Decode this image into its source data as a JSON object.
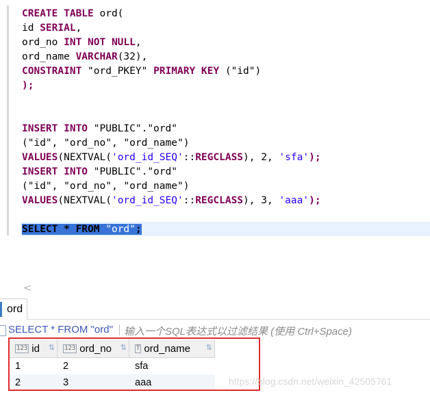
{
  "editor": {
    "lines": [
      [
        {
          "t": "CREATE TABLE",
          "k": "kw"
        },
        {
          "t": " ord(",
          "k": "fn"
        }
      ],
      [
        {
          "t": "id ",
          "k": "fn"
        },
        {
          "t": "SERIAL",
          "k": "kw"
        },
        {
          "t": ",",
          "k": "fn"
        }
      ],
      [
        {
          "t": "ord_no ",
          "k": "fn"
        },
        {
          "t": "INT NOT NULL",
          "k": "kw"
        },
        {
          "t": ",",
          "k": "fn"
        }
      ],
      [
        {
          "t": "ord_name ",
          "k": "fn"
        },
        {
          "t": "VARCHAR",
          "k": "kw"
        },
        {
          "t": "(32),",
          "k": "fn"
        }
      ],
      [
        {
          "t": "CONSTRAINT",
          "k": "kw"
        },
        {
          "t": " \"ord_PKEY\" ",
          "k": "dq"
        },
        {
          "t": "PRIMARY KEY",
          "k": "kw"
        },
        {
          "t": " (\"id\")",
          "k": "dq"
        }
      ],
      [
        {
          "t": ");",
          "k": "kw"
        }
      ],
      [],
      [],
      [
        {
          "t": "INSERT INTO",
          "k": "kw"
        },
        {
          "t": " \"PUBLIC\".\"ord\"",
          "k": "dq"
        }
      ],
      [
        {
          "t": "(\"id\", \"ord_no\", \"ord_name\")",
          "k": "dq"
        }
      ],
      [
        {
          "t": "VALUES",
          "k": "kw"
        },
        {
          "t": "(NEXTVAL(",
          "k": "fn"
        },
        {
          "t": "'ord_id_SEQ'",
          "k": "str"
        },
        {
          "t": "::",
          "k": "fn"
        },
        {
          "t": "REGCLASS",
          "k": "kw"
        },
        {
          "t": "), 2, ",
          "k": "fn"
        },
        {
          "t": "'sfa'",
          "k": "str"
        },
        {
          "t": ");",
          "k": "kw"
        }
      ],
      [
        {
          "t": "INSERT INTO",
          "k": "kw"
        },
        {
          "t": " \"PUBLIC\".\"ord\"",
          "k": "dq"
        }
      ],
      [
        {
          "t": "(\"id\", \"ord_no\", \"ord_name\")",
          "k": "dq"
        }
      ],
      [
        {
          "t": "VALUES",
          "k": "kw"
        },
        {
          "t": "(NEXTVAL(",
          "k": "fn"
        },
        {
          "t": "'ord_id_SEQ'",
          "k": "str"
        },
        {
          "t": "::",
          "k": "fn"
        },
        {
          "t": "REGCLASS",
          "k": "kw"
        },
        {
          "t": "), 3, ",
          "k": "fn"
        },
        {
          "t": "'aaa'",
          "k": "str"
        },
        {
          "t": ");",
          "k": "kw"
        }
      ],
      [],
      [
        {
          "t": "SELECT * FROM",
          "k": "kw",
          "sel": true
        },
        {
          "t": " \"ord\"",
          "k": "dq",
          "sel": true
        },
        {
          "t": ";",
          "k": "kw",
          "sel": true
        }
      ]
    ]
  },
  "scroll": {
    "arrow": "<"
  },
  "results_tab": {
    "label": "ord"
  },
  "filter": {
    "query": "SELECT * FROM \"ord\"",
    "placeholder": "输入一个SQL表达式以过滤结果 (使用 Ctrl+Space)"
  },
  "grid": {
    "columns": [
      {
        "name": "id",
        "icon": "123"
      },
      {
        "name": "ord_no",
        "icon": "123"
      },
      {
        "name": "ord_name",
        "icon": "T"
      }
    ],
    "rows": [
      [
        "1",
        "2",
        "sfa"
      ],
      [
        "2",
        "3",
        "aaa"
      ]
    ]
  },
  "watermark": "https://blog.csdn.net/weixin_42505761",
  "colors": {
    "highlight_box": "#e0292b",
    "selection": "#3874d8",
    "keyword": "#7f0055",
    "string": "#2a00ff"
  }
}
